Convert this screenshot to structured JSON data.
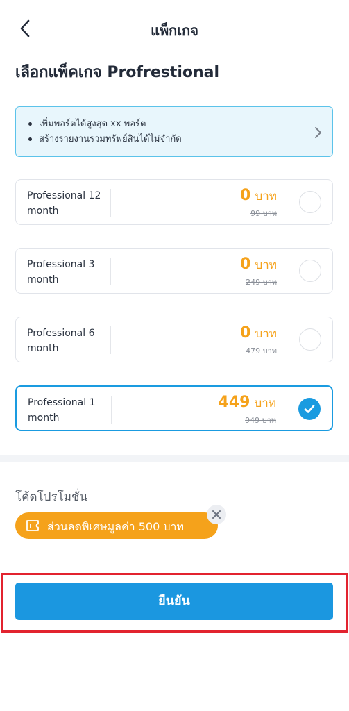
{
  "header": {
    "title": "แพ็กเกจ",
    "back_icon": "chevron-left-icon"
  },
  "page_title": "เลือกแพ็คเกจ Profrestional",
  "benefits": {
    "items": [
      "เพิ่มพอร์ตได้สูงสุด xx พอร์ต",
      "สร้างรายงานรวมทรัพย์สินได้ไม่จำกัด"
    ],
    "chevron_icon": "chevron-right-icon"
  },
  "plans": [
    {
      "name": "Professional 12 month",
      "price": "0",
      "unit": "บาท",
      "old_price": "99 บาท",
      "selected": false
    },
    {
      "name": "Professional 3 month",
      "price": "0",
      "unit": "บาท",
      "old_price": "249 บาท",
      "selected": false
    },
    {
      "name": "Professional 6 month",
      "price": "0",
      "unit": "บาท",
      "old_price": "479 บาท",
      "selected": false
    },
    {
      "name": "Professional 1 month",
      "price": "449",
      "unit": "บาท",
      "old_price": "949 บาท",
      "selected": true
    }
  ],
  "promo": {
    "label": "โค้ดโปรโมชั่น",
    "chip_text": "ส่วนลดพิเศษมูลค่า 500 บาท",
    "chip_icon": "ticket-icon",
    "remove_icon": "close-icon"
  },
  "confirm_label": "ยืนยัน",
  "colors": {
    "accent": "#1b97e0",
    "price": "#f5a21b",
    "highlight": "#e2232f"
  }
}
